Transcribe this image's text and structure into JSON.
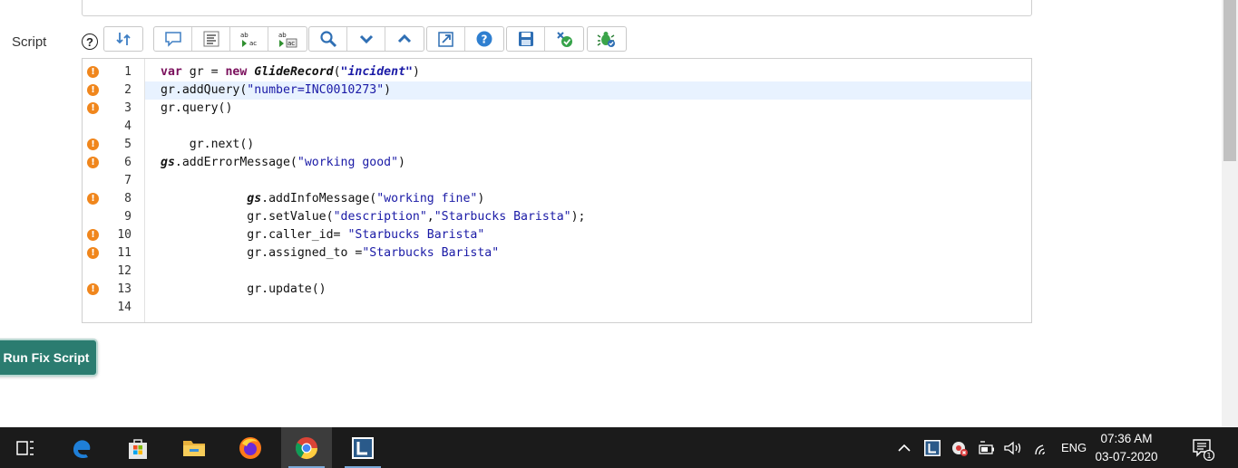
{
  "field": {
    "label": "Script",
    "help_glyph": "?"
  },
  "toolbar": {
    "groups": [
      [
        "swap-icon"
      ],
      [
        "comment-icon",
        "format-icon",
        "replace-icon",
        "replace-all-icon"
      ],
      [
        "search-icon",
        "next-icon",
        "previous-icon"
      ],
      [
        "fullscreen-icon",
        "help-icon"
      ],
      [
        "save-icon",
        "check-syntax-icon"
      ],
      [
        "debug-icon"
      ]
    ]
  },
  "editor": {
    "active_line": 2,
    "lines": [
      {
        "n": "1",
        "warn": true
      },
      {
        "n": "2",
        "warn": true
      },
      {
        "n": "3",
        "warn": true
      },
      {
        "n": "4",
        "warn": false
      },
      {
        "n": "5",
        "warn": true
      },
      {
        "n": "6",
        "warn": true
      },
      {
        "n": "7",
        "warn": false
      },
      {
        "n": "8",
        "warn": true
      },
      {
        "n": "9",
        "warn": false
      },
      {
        "n": "10",
        "warn": true
      },
      {
        "n": "11",
        "warn": true
      },
      {
        "n": "12",
        "warn": false
      },
      {
        "n": "13",
        "warn": true
      },
      {
        "n": "14",
        "warn": false
      }
    ],
    "code": {
      "l1": [
        "var",
        " gr = ",
        "new",
        " ",
        "GlideRecord",
        "(",
        "\"incident\"",
        ")"
      ],
      "l2": [
        "gr.addQuery(",
        "\"number=INC0010273\"",
        ")"
      ],
      "l3": "gr.query()",
      "l5": "    gr.next()",
      "l6": [
        "gs",
        ".addErrorMessage(",
        "\"working good\"",
        ")"
      ],
      "l8": [
        "            ",
        "gs",
        ".addInfoMessage(",
        "\"working fine\"",
        ")"
      ],
      "l9": [
        "            gr.setValue(",
        "\"description\"",
        ",",
        "\"Starbucks Barista\"",
        ");"
      ],
      "l10": [
        "            gr.caller_id= ",
        "\"Starbucks Barista\""
      ],
      "l11": [
        "            gr.assigned_to =",
        "\"Starbucks Barista\""
      ],
      "l13": "            gr.update()"
    },
    "warn_glyph": "!"
  },
  "run_button": {
    "label": "Run Fix Script"
  },
  "taskbar": {
    "apps": [
      "task-view-icon",
      "edge-icon",
      "store-icon",
      "file-explorer-icon",
      "firefox-icon",
      "chrome-icon",
      "app-l-icon"
    ],
    "active_app": "chrome-icon",
    "tray": {
      "language": "ENG",
      "time": "07:36 AM",
      "date": "03-07-2020",
      "notification_count": "1"
    }
  },
  "colors": {
    "accent": "#2b7c70",
    "warning": "#f0861c",
    "keyword": "#7a0f5c",
    "string": "#1a1aa6",
    "active_line": "#e8f2ff",
    "taskbar": "#1b1b1b"
  }
}
